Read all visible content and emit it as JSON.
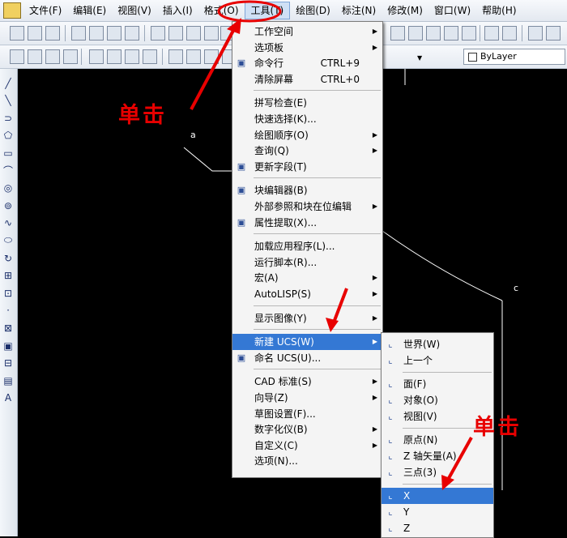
{
  "menubar": {
    "items": [
      {
        "label": "文件(F)",
        "name": "menu-file"
      },
      {
        "label": "编辑(E)",
        "name": "menu-edit"
      },
      {
        "label": "视图(V)",
        "name": "menu-view"
      },
      {
        "label": "插入(I)",
        "name": "menu-insert"
      },
      {
        "label": "格式(O)",
        "name": "menu-format"
      },
      {
        "label": "工具(T)",
        "name": "menu-tools",
        "active": true
      },
      {
        "label": "绘图(D)",
        "name": "menu-draw"
      },
      {
        "label": "标注(N)",
        "name": "menu-dimension"
      },
      {
        "label": "修改(M)",
        "name": "menu-modify"
      },
      {
        "label": "窗口(W)",
        "name": "menu-window"
      },
      {
        "label": "帮助(H)",
        "name": "menu-help"
      }
    ]
  },
  "properties_toolbar": {
    "layer_combo": "ByLayer"
  },
  "tools_menu": {
    "items": [
      {
        "label": "工作空间",
        "submenu": true
      },
      {
        "label": "选项板",
        "submenu": true
      },
      {
        "label": "命令行",
        "shortcut": "CTRL+9",
        "icon": "command-line-icon"
      },
      {
        "label": "清除屏幕",
        "shortcut": "CTRL+0"
      },
      {
        "separator": true
      },
      {
        "label": "拼写检查(E)"
      },
      {
        "label": "快速选择(K)..."
      },
      {
        "label": "绘图顺序(O)",
        "submenu": true
      },
      {
        "label": "查询(Q)",
        "submenu": true
      },
      {
        "label": "更新字段(T)",
        "icon": "update-fields-icon"
      },
      {
        "separator": true
      },
      {
        "label": "块编辑器(B)",
        "icon": "block-editor-icon"
      },
      {
        "label": "外部参照和块在位编辑",
        "submenu": true
      },
      {
        "label": "属性提取(X)...",
        "icon": "attribute-extract-icon"
      },
      {
        "separator": true
      },
      {
        "label": "加载应用程序(L)..."
      },
      {
        "label": "运行脚本(R)..."
      },
      {
        "label": "宏(A)",
        "submenu": true
      },
      {
        "label": "AutoLISP(S)",
        "submenu": true
      },
      {
        "separator": true
      },
      {
        "label": "显示图像(Y)",
        "submenu": true
      },
      {
        "separator": true
      },
      {
        "label": "新建 UCS(W)",
        "submenu": true,
        "highlighted": true
      },
      {
        "label": "命名 UCS(U)...",
        "icon": "named-ucs-icon"
      },
      {
        "separator": true
      },
      {
        "label": "CAD 标准(S)",
        "submenu": true
      },
      {
        "label": "向导(Z)",
        "submenu": true
      },
      {
        "label": "草图设置(F)..."
      },
      {
        "label": "数字化仪(B)",
        "submenu": true
      },
      {
        "label": "自定义(C)",
        "submenu": true
      },
      {
        "label": "选项(N)..."
      }
    ]
  },
  "ucs_submenu": {
    "items": [
      {
        "label": "世界(W)",
        "icon": "ucs-world-icon"
      },
      {
        "label": "上一个",
        "icon": "ucs-previous-icon"
      },
      {
        "separator": true
      },
      {
        "label": "面(F)",
        "icon": "ucs-face-icon"
      },
      {
        "label": "对象(O)",
        "icon": "ucs-object-icon"
      },
      {
        "label": "视图(V)",
        "icon": "ucs-view-icon"
      },
      {
        "separator": true
      },
      {
        "label": "原点(N)",
        "icon": "ucs-origin-icon"
      },
      {
        "label": "Z 轴矢量(A)",
        "icon": "ucs-zaxis-icon"
      },
      {
        "label": "三点(3)",
        "icon": "ucs-3point-icon"
      },
      {
        "separator": true
      },
      {
        "label": "X",
        "icon": "ucs-x-icon",
        "highlighted": true
      },
      {
        "label": "Y",
        "icon": "ucs-y-icon"
      },
      {
        "label": "Z",
        "icon": "ucs-z-icon"
      }
    ]
  },
  "annotations": {
    "click_top": "单击",
    "click_bottom": "单击"
  },
  "colors": {
    "highlight": "#3478d4",
    "annotation_red": "#e80000",
    "canvas": "#000000"
  }
}
